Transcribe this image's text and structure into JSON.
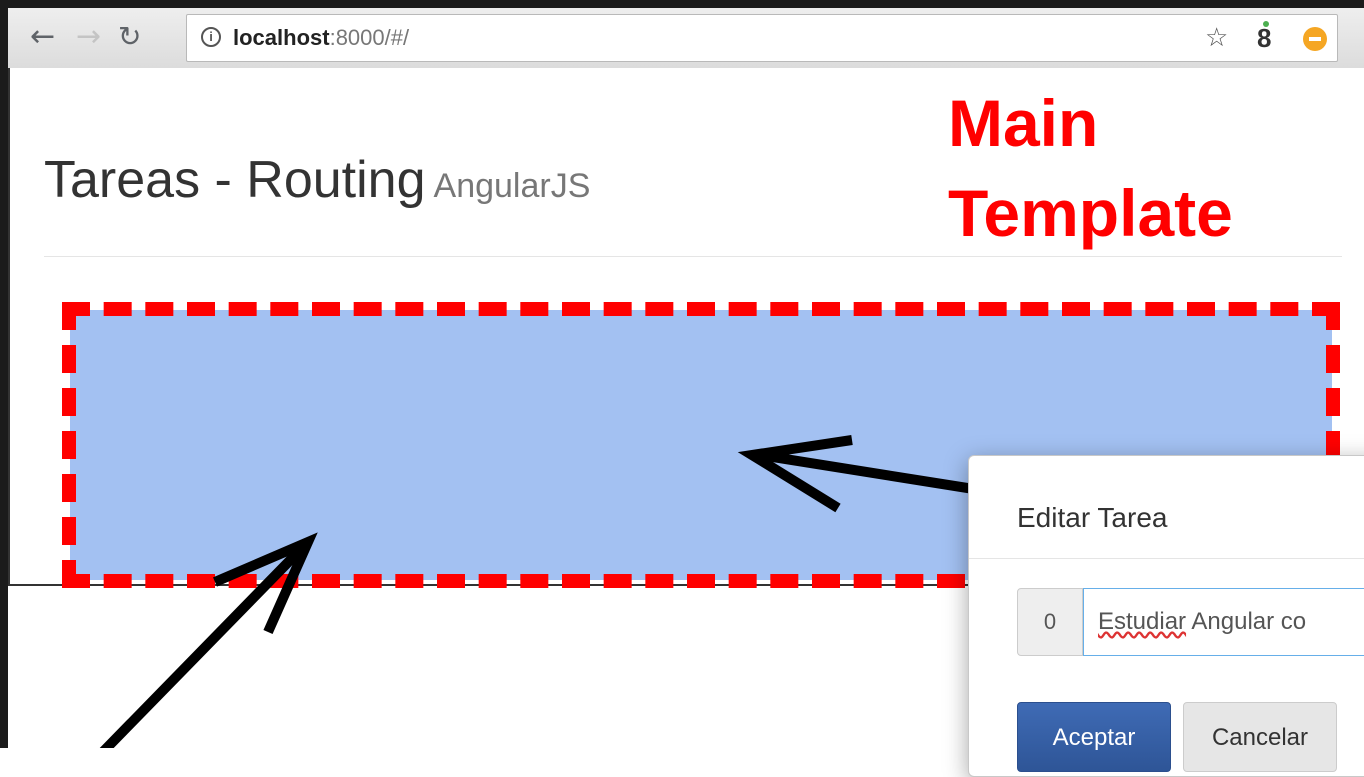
{
  "browser": {
    "url_host": "localhost",
    "url_path": ":8000/#/",
    "info_icon": "info-icon",
    "nav_icons": [
      "back-arrow-icon",
      "forward-arrow-icon",
      "reload-icon"
    ],
    "toolbar_icons": [
      "star-icon",
      "extension-icon",
      "extension-orange-icon"
    ]
  },
  "page": {
    "title": "Tareas - Routing",
    "subtitle": "AngularJS"
  },
  "annotation": {
    "line1": "Main",
    "line2": "Template",
    "color": "#ff0000"
  },
  "view": {
    "fill_color": "#a3c1f2",
    "border_color": "#ff0000"
  },
  "modal": {
    "title": "Editar Tarea",
    "addon_value": "0",
    "input_value_word1": "Estudiar",
    "input_value_rest": " Angular co",
    "accept_label": "Aceptar",
    "cancel_label": "Cancelar"
  }
}
